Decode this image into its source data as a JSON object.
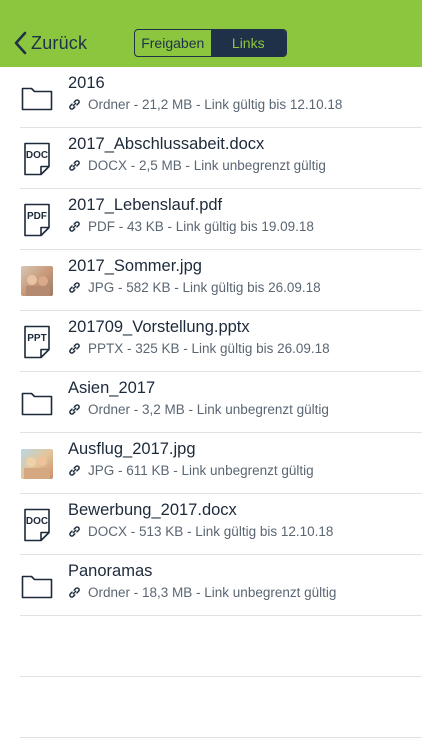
{
  "header": {
    "back_label": "Zurück",
    "segments": [
      {
        "label": "Freigaben",
        "active": false
      },
      {
        "label": "Links",
        "active": true
      }
    ],
    "bar_color": "#8cc63f",
    "accent_color": "#1f3148"
  },
  "files": [
    {
      "name": "2016",
      "meta": "Ordner - 21,2 MB - Link gültig bis 12.10.18",
      "icon": "folder-icon"
    },
    {
      "name": "2017_Abschlussabeit.docx",
      "meta": "DOCX - 2,5 MB - Link unbegrenzt gültig",
      "icon": "doc-file-icon",
      "badge": "DOC"
    },
    {
      "name": "2017_Lebenslauf.pdf",
      "meta": "PDF - 43 KB - Link gültig bis 19.09.18",
      "icon": "pdf-file-icon",
      "badge": "PDF"
    },
    {
      "name": "2017_Sommer.jpg",
      "meta": "JPG - 582 KB - Link gültig bis 26.09.18",
      "icon": "image-thumbnail"
    },
    {
      "name": "201709_Vorstellung.pptx",
      "meta": "PPTX - 325 KB - Link gültig bis 26.09.18",
      "icon": "ppt-file-icon",
      "badge": "PPT"
    },
    {
      "name": "Asien_2017",
      "meta": "Ordner - 3,2 MB - Link unbegrenzt gültig",
      "icon": "folder-icon"
    },
    {
      "name": "Ausflug_2017.jpg",
      "meta": "JPG - 611 KB - Link unbegrenzt gültig",
      "icon": "image-thumbnail"
    },
    {
      "name": "Bewerbung_2017.docx",
      "meta": "DOCX - 513 KB - Link gültig bis 12.10.18",
      "icon": "doc-file-icon",
      "badge": "DOC"
    },
    {
      "name": "Panoramas",
      "meta": "Ordner - 18,3 MB - Link unbegrenzt gültig",
      "icon": "folder-icon"
    }
  ]
}
